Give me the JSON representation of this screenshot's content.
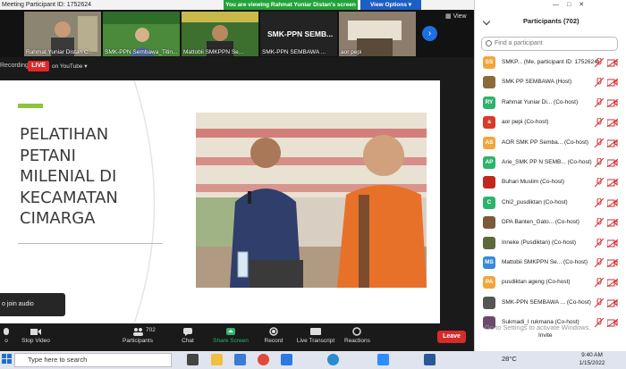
{
  "window": {
    "title_prefix": "Meeting Participant ID: 1752624",
    "share_banner": "You are viewing Rahmat Yuniar Distan's screen",
    "view_options": "View Options ▾",
    "view_label": "View"
  },
  "gallery": {
    "tiles": [
      {
        "label": "Rahmat Yuniar Distan C...",
        "big": ""
      },
      {
        "label": "SMK-PPN Sembawa_Titin...",
        "big": ""
      },
      {
        "label": "Mattobii SMKPPN Se...",
        "big": ""
      },
      {
        "label": "SMK-PPN SEMBAWA ...",
        "big": "SMK-PPN  SEMB..."
      },
      {
        "label": "aor pepi",
        "big": ""
      }
    ]
  },
  "recording": {
    "label": "Recording",
    "live": "LIVE",
    "on_youtube": "on YouTube ▾"
  },
  "slide": {
    "title_lines": [
      "PELATIHAN",
      "PETANI",
      "MILENIAL DI",
      "KECAMATAN",
      "CIMARGA"
    ]
  },
  "join_audio": "o join audio",
  "toolbar": {
    "items": [
      {
        "label": "o",
        "icon": "audio-icon"
      },
      {
        "label": "Stop Video",
        "icon": "video-icon"
      },
      {
        "label": "Participants",
        "icon": "participants-icon",
        "count": "702"
      },
      {
        "label": "Chat",
        "icon": "chat-icon"
      },
      {
        "label": "Share Screen",
        "icon": "share-screen-icon"
      },
      {
        "label": "Record",
        "icon": "record-icon"
      },
      {
        "label": "Live Transcript",
        "icon": "cc-icon"
      },
      {
        "label": "Reactions",
        "icon": "reactions-icon"
      }
    ],
    "leave": "Leave"
  },
  "panel": {
    "title": "Participants (702)",
    "search_placeholder": "Find a participant",
    "participants": [
      {
        "initials": "SS",
        "color": "#f0a63d",
        "name": "SMKP... (Me, participant ID: 1752624)"
      },
      {
        "initials": "",
        "color": "#8a6b3a",
        "name": "SMK PP SEMBAWA (Host)"
      },
      {
        "initials": "RY",
        "color": "#2db36b",
        "name": "Rahmat Yuniar Di... (Co-host)"
      },
      {
        "initials": "a",
        "color": "#d93a2b",
        "name": "aor pepi (Co-host)"
      },
      {
        "initials": "AS",
        "color": "#f0a63d",
        "name": "AOR SMK PP Semba... (Co-host)"
      },
      {
        "initials": "AP",
        "color": "#2db36b",
        "name": "Arie_SMK PP N SEMB... (Co-host)"
      },
      {
        "initials": "",
        "color": "#c0281c",
        "name": "Buhari Muslim (Co-host)"
      },
      {
        "initials": "C",
        "color": "#2db36b",
        "name": "Chi2_pusdiktan (Co-host)"
      },
      {
        "initials": "",
        "color": "#7a5a3a",
        "name": "DPA Banten_Gato... (Co-host)"
      },
      {
        "initials": "",
        "color": "#5a6a3a",
        "name": "Inneke (Pusdiktan) (Co-host)"
      },
      {
        "initials": "MS",
        "color": "#3a8ad9",
        "name": "Mattobii SMKPPN Se... (Co-host)"
      },
      {
        "initials": "PA",
        "color": "#f0a63d",
        "name": "pusdiktan ageng (Co-host)"
      },
      {
        "initials": "",
        "color": "#555555",
        "name": "SMK-PPN SEMBAWA ... (Co-host)"
      },
      {
        "initials": "",
        "color": "#6a4a6a",
        "name": "Sukmadi_I rukmana (Co-host)"
      }
    ],
    "activate": "Go to Settings to activate Windows.",
    "invite": "Invite"
  },
  "taskbar": {
    "search": "Type here to search",
    "temp": "28°C",
    "time": "9:40 AM",
    "date": "1/15/2022"
  }
}
